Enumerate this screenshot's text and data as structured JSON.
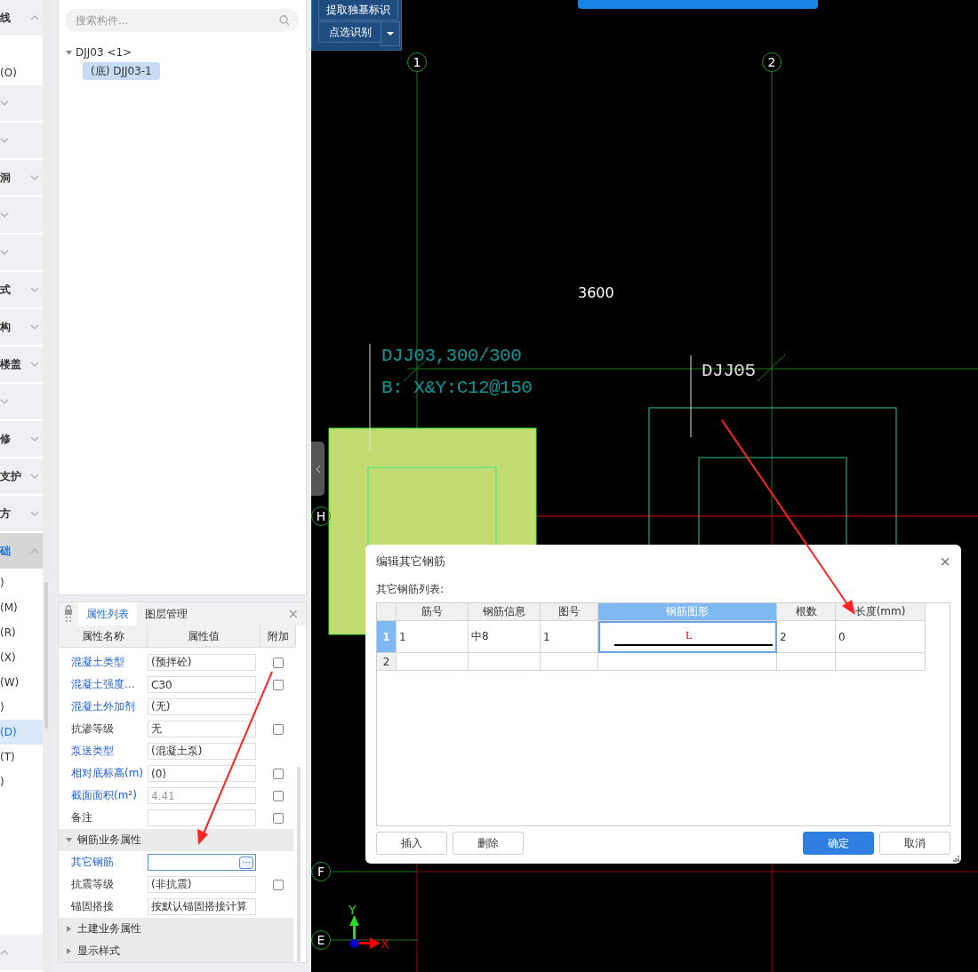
{
  "left_strip": {
    "items": [
      {
        "kind": "header",
        "label": "线",
        "expanded": true,
        "selected": false
      },
      {
        "kind": "item",
        "label": "(O)",
        "selected": false
      },
      {
        "kind": "header",
        "expanded": false,
        "selected": false
      },
      {
        "kind": "header",
        "expanded": false,
        "selected": false
      },
      {
        "kind": "header",
        "label": "洞",
        "expanded": false,
        "selected": false
      },
      {
        "kind": "header",
        "expanded": false,
        "selected": false
      },
      {
        "kind": "header",
        "expanded": false,
        "selected": false
      },
      {
        "kind": "header",
        "label": "式",
        "expanded": false,
        "selected": false
      },
      {
        "kind": "header",
        "label": "构",
        "expanded": false,
        "selected": false
      },
      {
        "kind": "header",
        "label": "楼盖",
        "expanded": false,
        "selected": false
      },
      {
        "kind": "header",
        "expanded": false,
        "selected": false
      },
      {
        "kind": "header",
        "label": "修",
        "expanded": false,
        "selected": false
      },
      {
        "kind": "header",
        "label": "支护",
        "expanded": false,
        "selected": false
      },
      {
        "kind": "header",
        "label": "方",
        "expanded": false,
        "selected": false
      },
      {
        "kind": "header",
        "label": "础",
        "expanded": true,
        "selected": true
      },
      {
        "kind": "item",
        "label": ")",
        "selected": false
      },
      {
        "kind": "item",
        "label": "(M)",
        "selected": false
      },
      {
        "kind": "item",
        "label": "(R)",
        "selected": false
      },
      {
        "kind": "item",
        "label": "(X)",
        "selected": false
      },
      {
        "kind": "item",
        "label": "(W)",
        "selected": false
      },
      {
        "kind": "item",
        "label": ")",
        "selected": false
      },
      {
        "kind": "item",
        "label": "(D)",
        "selected": true
      },
      {
        "kind": "item",
        "label": "(T)",
        "selected": false
      },
      {
        "kind": "item",
        "label": ")",
        "selected": false
      },
      {
        "kind": "header",
        "expanded": true,
        "selected": false
      }
    ]
  },
  "component_panel": {
    "search": {
      "placeholder": "搜索构件..."
    },
    "tree": [
      {
        "label": "DJJ03 <1>",
        "expanded": true,
        "children": [
          {
            "label": "(底) DJJ03-1",
            "selected": true
          }
        ]
      }
    ]
  },
  "property_panel": {
    "tabs": [
      {
        "label": "属性列表",
        "selected": true
      },
      {
        "label": "图层管理",
        "selected": false
      }
    ],
    "close": "×",
    "columns": [
      "属性名称",
      "属性值",
      "附加"
    ],
    "sections": [
      {
        "kind": "rows",
        "rows": [
          {
            "name": "混凝土类型",
            "value": "(预拌砼)",
            "link": true,
            "checked": false
          },
          {
            "name": "混凝土强度...",
            "value": "C30",
            "link": true,
            "checked": false
          },
          {
            "name": "混凝土外加剂",
            "value": "(无)",
            "link": true
          },
          {
            "name": "抗渗等级",
            "value": "无",
            "link": false,
            "checked": false
          },
          {
            "name": "泵送类型",
            "value": "(混凝土泵)",
            "link": true
          },
          {
            "name": "相对底标高(m)",
            "value": "(0)",
            "link": true,
            "checked": false
          },
          {
            "name": "截面面积(m²)",
            "value": "4.41",
            "link": true,
            "disabled": true,
            "checked": false
          },
          {
            "name": "备注",
            "link": false,
            "checked": false
          }
        ]
      },
      {
        "kind": "group",
        "label": "钢筋业务属性",
        "expanded": true,
        "rows": [
          {
            "name": "其它钢筋",
            "link": true,
            "picker": "···"
          },
          {
            "name": "抗震等级",
            "value": "(非抗震)",
            "link": false,
            "checked": false
          },
          {
            "name": "锚固搭接",
            "value": "按默认锚固搭接计算",
            "link": false
          }
        ]
      },
      {
        "kind": "group",
        "label": "土建业务属性",
        "expanded": false
      },
      {
        "kind": "group",
        "label": "显示样式",
        "expanded": false
      }
    ]
  },
  "canvas": {
    "tool_buttons": [
      "提取独基标识",
      "点选识别"
    ],
    "axes": [
      {
        "label": "1",
        "kind": "vertical"
      },
      {
        "label": "2",
        "kind": "vertical"
      },
      {
        "label": "H",
        "kind": "horizontal"
      },
      {
        "label": "F",
        "kind": "horizontal"
      },
      {
        "label": "E",
        "kind": "horizontal"
      }
    ],
    "dimension": "3600",
    "annotations": [
      {
        "kind": "teal",
        "lines": [
          "DJJ03,300/300",
          "B: X&Y:C12@150"
        ]
      },
      {
        "kind": "white",
        "lines": [
          "DJJ05"
        ]
      }
    ],
    "ucs": {
      "y": "Y",
      "x": "X"
    }
  },
  "dialog": {
    "title": "编辑其它钢筋",
    "close": "×",
    "list_label": "其它钢筋列表:",
    "columns": [
      {
        "label": "筋号",
        "selected": false
      },
      {
        "label": "钢筋信息",
        "selected": false
      },
      {
        "label": "图号",
        "selected": false
      },
      {
        "label": "钢筋图形",
        "selected": true
      },
      {
        "label": "根数",
        "selected": false
      },
      {
        "label": "长度(mm)",
        "selected": false
      }
    ],
    "rows": [
      {
        "number": "1",
        "selected": true,
        "cells": [
          {
            "kind": "text",
            "text": "1"
          },
          {
            "kind": "text",
            "text": "中8"
          },
          {
            "kind": "text",
            "text": "1"
          },
          {
            "kind": "shape",
            "text": "L"
          },
          {
            "kind": "text",
            "text": "2"
          },
          {
            "kind": "text",
            "text": "0"
          }
        ]
      },
      {
        "number": "2",
        "selected": false
      }
    ],
    "buttons": [
      {
        "label": "插入",
        "primary": false
      },
      {
        "label": "删除",
        "primary": false
      },
      {
        "label": "确定",
        "primary": true
      },
      {
        "label": "取消",
        "primary": false
      }
    ]
  }
}
